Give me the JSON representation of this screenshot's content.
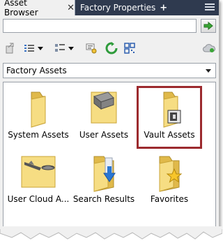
{
  "tabs": [
    {
      "label": "Asset Browser",
      "active": true,
      "close_glyph": "✕"
    },
    {
      "label": "Factory Properties",
      "active": false,
      "add_glyph": "+"
    }
  ],
  "search": {
    "value": "",
    "placeholder": ""
  },
  "toolbar": {
    "buttons": [
      "import-icon",
      "list-view-icon",
      "thumbnail-view-icon",
      "properties-icon",
      "refresh-icon",
      "qr-code-icon",
      "cloud-status-icon"
    ]
  },
  "library_dropdown": {
    "selected": "Factory Assets"
  },
  "items": [
    {
      "label": "System Assets",
      "icon": "folder-icon"
    },
    {
      "label": "User Assets",
      "icon": "folder-with-asset-icon"
    },
    {
      "label": "Vault Assets",
      "icon": "folder-with-vault-icon"
    },
    {
      "label": "User Cloud A...",
      "icon": "folder-with-cloud-asset-icon"
    },
    {
      "label": "Search Results",
      "icon": "folder-with-download-icon"
    },
    {
      "label": "Favorites",
      "icon": "folder-with-star-icon"
    }
  ],
  "colors": {
    "tabbar_bg": "#2f3a4f",
    "highlight": "#9c2a2e",
    "folder": "#f3d774"
  }
}
